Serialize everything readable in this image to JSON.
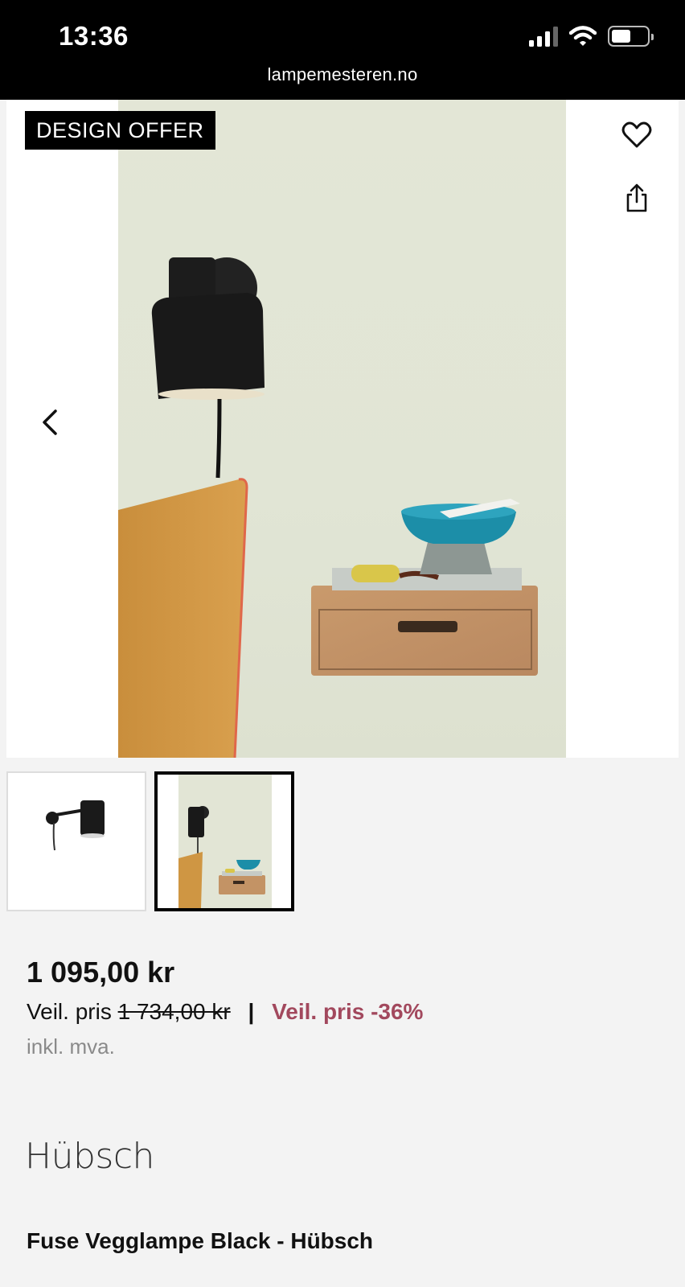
{
  "status_bar": {
    "time": "13:36",
    "url": "lampemesteren.no"
  },
  "gallery": {
    "badge": "DESIGN OFFER",
    "icons": [
      "chevron-left-icon",
      "heart-icon",
      "share-icon"
    ],
    "thumbnail_count": 2,
    "active_thumbnail": 2
  },
  "pricing": {
    "price": "1 095,00 kr",
    "recommended_label": "Veil. pris",
    "recommended_price": "1 734,00 kr",
    "separator": "|",
    "discount": "Veil. pris -36%",
    "vat_note": "inkl. mva."
  },
  "brand": "Hübsch",
  "product_title": "Fuse Vegglampe Black - Hübsch",
  "colors": {
    "status_bar_bg": "#000000",
    "page_bg": "#f3f3f3",
    "discount": "#a2485d",
    "badge_bg": "#000000"
  }
}
